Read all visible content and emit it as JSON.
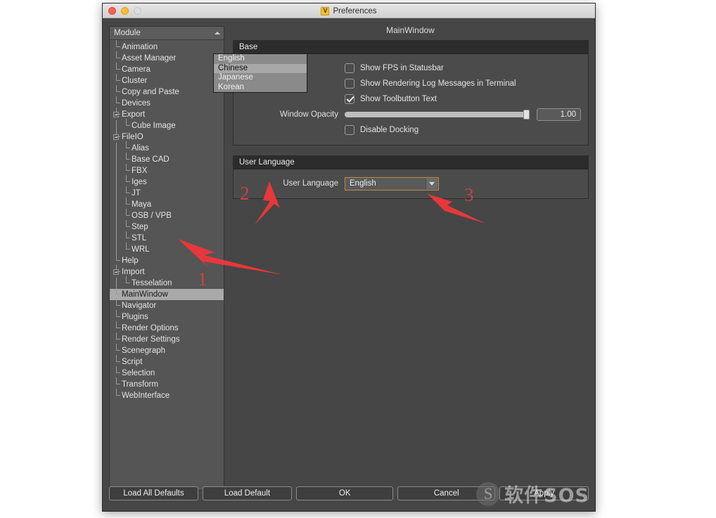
{
  "window": {
    "title": "Preferences",
    "app_icon": "V",
    "traffic_lights": [
      "close-button",
      "minimize-button",
      "zoom-button"
    ]
  },
  "header": {
    "page_title": "MainWindow"
  },
  "sidebar": {
    "header_label": "Module",
    "sort_indicator": "sort-ascending-icon",
    "selected": "MainWindow",
    "items": [
      {
        "label": "Animation",
        "depth": 1,
        "expandable": false
      },
      {
        "label": "Asset Manager",
        "depth": 1,
        "expandable": false
      },
      {
        "label": "Camera",
        "depth": 1,
        "expandable": false
      },
      {
        "label": "Cluster",
        "depth": 1,
        "expandable": false
      },
      {
        "label": "Copy and Paste",
        "depth": 1,
        "expandable": false
      },
      {
        "label": "Devices",
        "depth": 1,
        "expandable": false
      },
      {
        "label": "Export",
        "depth": 1,
        "expandable": true
      },
      {
        "label": "Cube Image",
        "depth": 2,
        "expandable": false
      },
      {
        "label": "FileIO",
        "depth": 1,
        "expandable": true
      },
      {
        "label": "Alias",
        "depth": 2,
        "expandable": false
      },
      {
        "label": "Base CAD",
        "depth": 2,
        "expandable": false
      },
      {
        "label": "FBX",
        "depth": 2,
        "expandable": false
      },
      {
        "label": "Iges",
        "depth": 2,
        "expandable": false
      },
      {
        "label": "JT",
        "depth": 2,
        "expandable": false
      },
      {
        "label": "Maya",
        "depth": 2,
        "expandable": false
      },
      {
        "label": "OSB / VPB",
        "depth": 2,
        "expandable": false
      },
      {
        "label": "Step",
        "depth": 2,
        "expandable": false
      },
      {
        "label": "STL",
        "depth": 2,
        "expandable": false
      },
      {
        "label": "WRL",
        "depth": 2,
        "expandable": false
      },
      {
        "label": "Help",
        "depth": 1,
        "expandable": false
      },
      {
        "label": "Import",
        "depth": 1,
        "expandable": true
      },
      {
        "label": "Tesselation",
        "depth": 2,
        "expandable": false
      },
      {
        "label": "MainWindow",
        "depth": 1,
        "expandable": false
      },
      {
        "label": "Navigator",
        "depth": 1,
        "expandable": false
      },
      {
        "label": "Plugins",
        "depth": 1,
        "expandable": false
      },
      {
        "label": "Render Options",
        "depth": 1,
        "expandable": false
      },
      {
        "label": "Render Settings",
        "depth": 1,
        "expandable": false
      },
      {
        "label": "Scenegraph",
        "depth": 1,
        "expandable": false
      },
      {
        "label": "Script",
        "depth": 1,
        "expandable": false
      },
      {
        "label": "Selection",
        "depth": 1,
        "expandable": false
      },
      {
        "label": "Transform",
        "depth": 1,
        "expandable": false
      },
      {
        "label": "WebInterface",
        "depth": 1,
        "expandable": false
      }
    ]
  },
  "base_group": {
    "title": "Base",
    "checkboxes": [
      {
        "label": "Show FPS in Statusbar",
        "checked": false
      },
      {
        "label": "Show Rendering Log Messages in Terminal",
        "checked": false
      },
      {
        "label": "Show Toolbutton Text",
        "checked": true
      }
    ],
    "opacity": {
      "label": "Window Opacity",
      "value": "1.00",
      "percent": 100
    },
    "disable_docking": {
      "label": "Disable Docking",
      "checked": false
    }
  },
  "language_group": {
    "title": "User Language",
    "field_label": "User Language",
    "selected": "English",
    "options": [
      "English",
      "Chinese",
      "Japanese",
      "Korean"
    ],
    "highlighted_option": "Chinese",
    "focus_border_color": "#c28b3e"
  },
  "footer": {
    "buttons": [
      "Load All Defaults",
      "Load Default",
      "OK",
      "Cancel",
      "Apply"
    ]
  },
  "annotations": {
    "numbers": [
      "1",
      "2",
      "3"
    ],
    "color": "#d2424a"
  },
  "watermark": {
    "text": "软件SOS",
    "logo": "S"
  }
}
